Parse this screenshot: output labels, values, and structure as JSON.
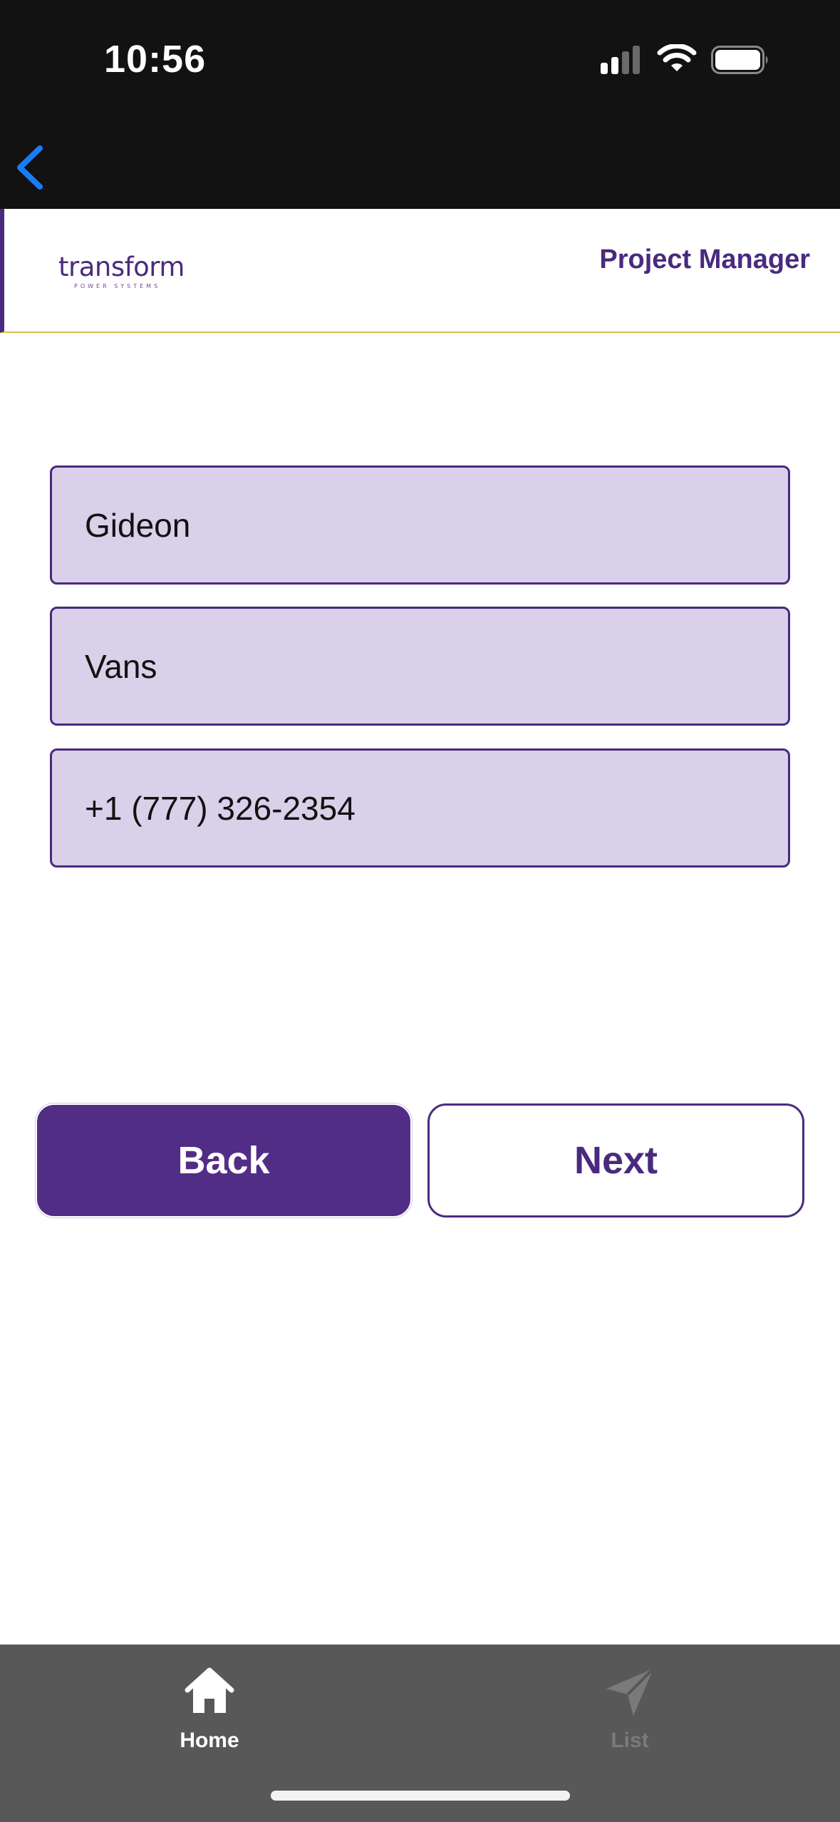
{
  "status_bar": {
    "time": "10:56",
    "icons": [
      "cellular-signal-icon",
      "wifi-icon",
      "battery-icon"
    ]
  },
  "nav": {
    "back_icon": "chevron-left-icon"
  },
  "header": {
    "logo_text": "transform",
    "logo_tagline": "POWER SYSTEMS",
    "role_title": "Project Manager"
  },
  "form": {
    "first_name": "Gideon",
    "last_name": "Vans",
    "phone": "+1 (777) 326-2354"
  },
  "actions": {
    "back_label": "Back",
    "next_label": "Next"
  },
  "tab_bar": {
    "tabs": [
      {
        "label": "Home",
        "icon": "home-icon",
        "active": true
      },
      {
        "label": "List",
        "icon": "send-icon",
        "active": false
      }
    ]
  },
  "colors": {
    "brand_purple": "#4a2a7e",
    "button_purple": "#522d85",
    "field_fill": "#d9d0e9",
    "header_accent_yellow": "#dcc43a",
    "status_bar_bg": "#121212",
    "tab_bar_bg": "#585858",
    "ios_blue": "#1a7cf5"
  }
}
